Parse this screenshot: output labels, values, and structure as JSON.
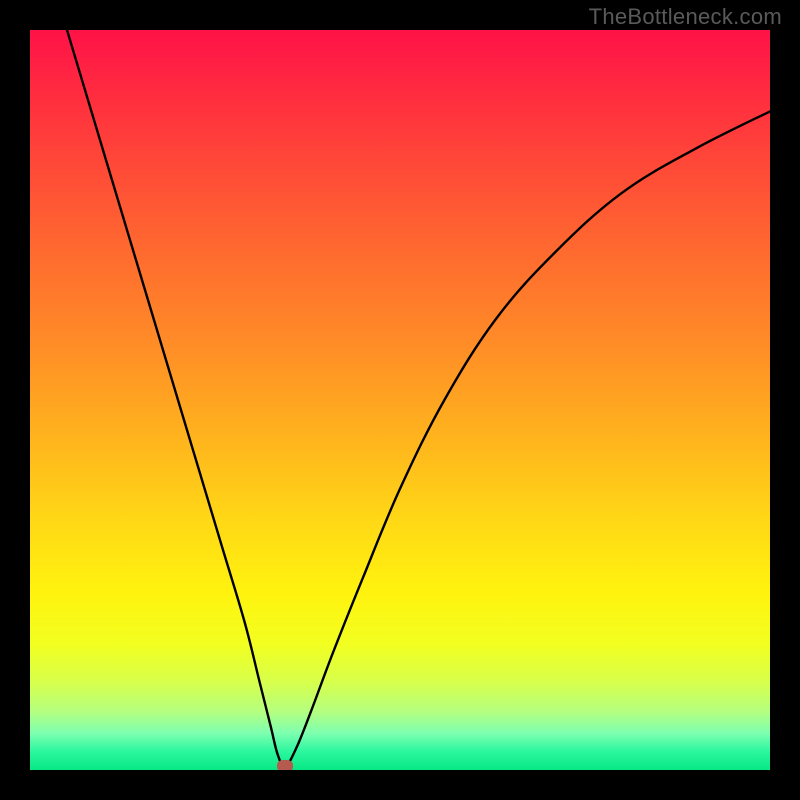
{
  "watermark": "TheBottleneck.com",
  "colors": {
    "frame": "#000000",
    "curve": "#000000",
    "marker": "#b45a4e"
  },
  "chart_data": {
    "type": "line",
    "title": "",
    "xlabel": "",
    "ylabel": "",
    "xlim": [
      0,
      100
    ],
    "ylim": [
      0,
      100
    ],
    "grid": false,
    "legend": false,
    "series": [
      {
        "name": "bottleneck-curve",
        "x": [
          5,
          8,
          11,
          14,
          17,
          20,
          23,
          26,
          29,
          31,
          32.5,
          33.5,
          34.5,
          36,
          38,
          41,
          45,
          50,
          56,
          63,
          71,
          80,
          90,
          100
        ],
        "y": [
          100,
          90,
          80,
          70,
          60,
          50,
          40,
          30,
          20,
          12,
          6,
          2,
          0.5,
          3,
          8,
          16,
          26,
          38,
          50,
          61,
          70,
          78,
          84,
          89
        ]
      }
    ],
    "markers": [
      {
        "name": "optimal-point",
        "x": 34.5,
        "y": 0.5
      }
    ],
    "background_gradient": {
      "top_color": "#ff1247",
      "mid_color": "#fff30e",
      "bottom_color": "#06e884"
    }
  }
}
